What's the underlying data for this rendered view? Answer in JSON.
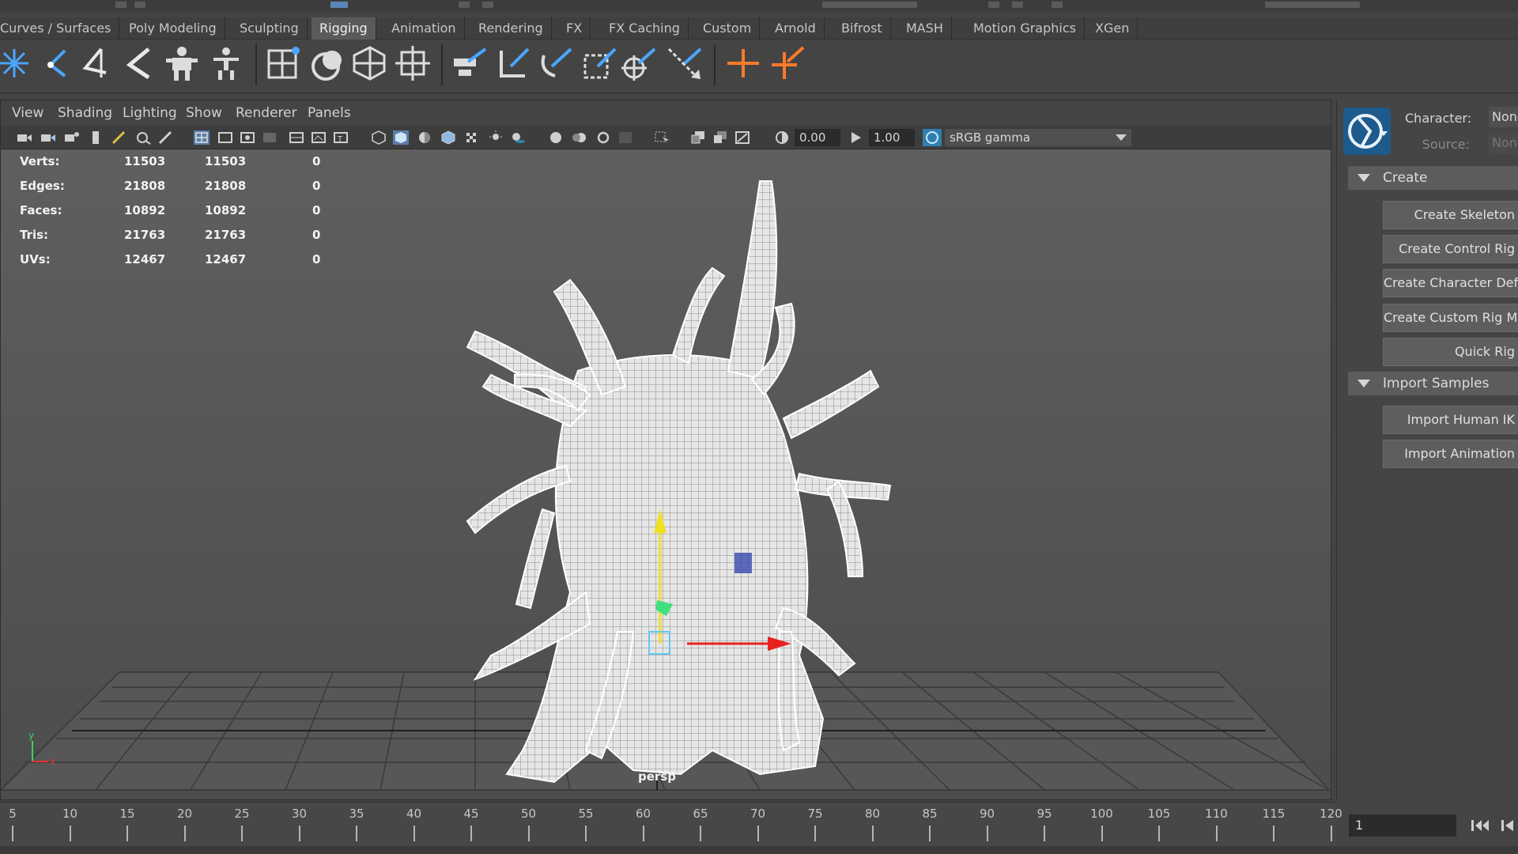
{
  "shelf_tabs": [
    {
      "label": "Curves / Surfaces",
      "active": false
    },
    {
      "label": "Poly Modeling",
      "active": false
    },
    {
      "label": "Sculpting",
      "active": false
    },
    {
      "label": "Rigging",
      "active": true
    },
    {
      "label": "Animation",
      "active": false
    },
    {
      "label": "Rendering",
      "active": false
    },
    {
      "label": "FX",
      "active": false
    },
    {
      "label": "FX Caching",
      "active": false
    },
    {
      "label": "Custom",
      "active": false
    },
    {
      "label": "Arnold",
      "active": false
    },
    {
      "label": "Bifrost",
      "active": false
    },
    {
      "label": "MASH",
      "active": false
    },
    {
      "label": "Motion Graphics",
      "active": false
    },
    {
      "label": "XGen",
      "active": false
    }
  ],
  "shelf_icons": [
    "create-joints-icon",
    "insert-joint-icon",
    "mirror-joint-icon",
    "orient-joint-icon",
    "humanik-skeleton-icon",
    "quick-rig-icon",
    "bind-skin-icon",
    "paint-skin-weights-icon",
    "lattice-icon",
    "cluster-icon",
    "ik-handle-icon",
    "ik-spline-icon",
    "point-constraint-icon",
    "scale-constraint-icon",
    "aim-constraint-icon",
    "pole-vector-constraint-icon",
    "locator-icon",
    "parent-constraint-icon"
  ],
  "viewport": {
    "menus": [
      "View",
      "Shading",
      "Lighting",
      "Show",
      "Renderer",
      "Panels"
    ],
    "exposure": "0.00",
    "gamma": "1.00",
    "color_space": "sRGB gamma",
    "camera_label": "persp",
    "hud": [
      {
        "label": "Verts:",
        "v1": "11503",
        "v2": "11503",
        "v3": "0"
      },
      {
        "label": "Edges:",
        "v1": "21808",
        "v2": "21808",
        "v3": "0"
      },
      {
        "label": "Faces:",
        "v1": "10892",
        "v2": "10892",
        "v3": "0"
      },
      {
        "label": "Tris:",
        "v1": "21763",
        "v2": "21763",
        "v3": "0"
      },
      {
        "label": "UVs:",
        "v1": "12467",
        "v2": "12467",
        "v3": "0"
      }
    ],
    "axis_labels": {
      "y": "y",
      "x": "x"
    }
  },
  "character_panel": {
    "character_label": "Character:",
    "character_value": "None",
    "source_label": "Source:",
    "source_value": "None",
    "create_section": "Create",
    "create_buttons": [
      "Create Skeleton",
      "Create Control Rig",
      "Create Character Definition",
      "Create Custom Rig Mapping",
      "Quick Rig"
    ],
    "import_section": "Import Samples",
    "import_buttons": [
      "Import Human IK",
      "Import Animation"
    ]
  },
  "timeline": {
    "ticks": [
      "5",
      "10",
      "15",
      "20",
      "25",
      "30",
      "35",
      "40",
      "45",
      "50",
      "55",
      "60",
      "65",
      "70",
      "75",
      "80",
      "85",
      "90",
      "95",
      "100",
      "105",
      "110",
      "115",
      "120"
    ],
    "current_frame": "1"
  }
}
